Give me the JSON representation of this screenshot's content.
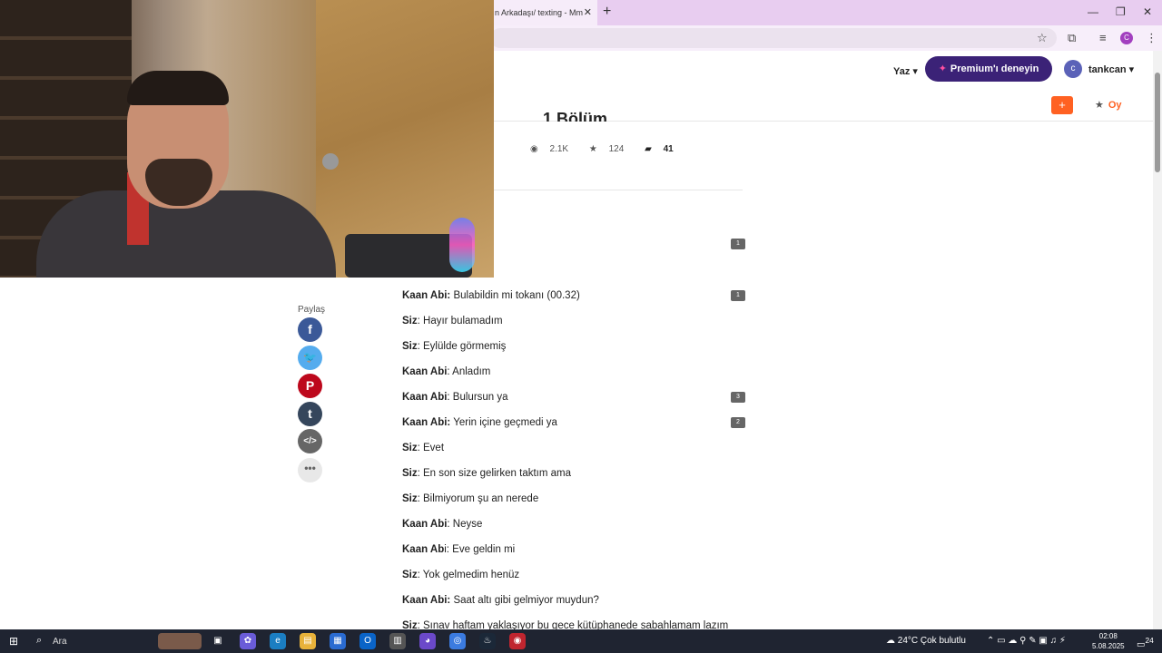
{
  "browser": {
    "tab_title": "n Arkadaşı/ texting - Mm",
    "tab_close": "✕",
    "new_tab": "+",
    "window_controls": {
      "minimize": "—",
      "maximize": "❐",
      "close": "✕"
    },
    "profile_initial": "C"
  },
  "site": {
    "write_label": "Yaz ▾",
    "premium_label": "Premium'ı deneyin",
    "user_initial": "c",
    "username": "tankcan ▾"
  },
  "story": {
    "chapter_title": "1.Bölüm",
    "add_button": "+",
    "vote_label": "Oy",
    "stats": {
      "reads": "2.1K",
      "votes": "124",
      "comments": "41"
    },
    "share_label": "Paylaş",
    "lines": [
      {
        "speaker": "Kaan Abi:",
        "text": " Bulabildin mi tokanı (00.32)",
        "comments": "1"
      },
      {
        "speaker": "Siz",
        "text": ": Hayır bulamadım",
        "comments": ""
      },
      {
        "speaker": "Siz",
        "text": ": Eylülde görmemiş",
        "comments": ""
      },
      {
        "speaker": "Kaan Abi",
        "text": ": Anladım",
        "comments": ""
      },
      {
        "speaker": "Kaan Abi",
        "text": ": Bulursun ya",
        "comments": "3"
      },
      {
        "speaker": "Kaan Abi:",
        "text": " Yerin içine geçmedi ya",
        "comments": "2"
      },
      {
        "speaker": "Siz",
        "text": ": Evet",
        "comments": ""
      },
      {
        "speaker": "Siz",
        "text": ": En son size gelirken taktım ama",
        "comments": ""
      },
      {
        "speaker": "Siz",
        "text": ": Bilmiyorum şu an nerede",
        "comments": ""
      },
      {
        "speaker": "Kaan Abi",
        "text": ": Neyse",
        "comments": ""
      },
      {
        "speaker": "Kaan Ab",
        "text": "i: Eve geldin mi",
        "comments": ""
      },
      {
        "speaker": "Siz",
        "text": ": Yok gelmedim henüz",
        "comments": ""
      },
      {
        "speaker": "Kaan Abi:",
        "text": " Saat altı gibi gelmiyor muydun?",
        "comments": ""
      },
      {
        "speaker": "Siz",
        "text": ": Sınav haftam yaklaşıyor bu gece kütüphanede sabahlamam lazım",
        "comments": ""
      }
    ],
    "top_bubble": "1"
  },
  "taskbar": {
    "search_placeholder": "Ara",
    "weather": "24°C  Çok bulutlu",
    "time": "02:08",
    "date": "5.08.2025",
    "notifications": "24"
  },
  "colors": {
    "premium": "#3b2277",
    "accent": "#ff6122",
    "tab_strip": "#e8cdf0"
  }
}
